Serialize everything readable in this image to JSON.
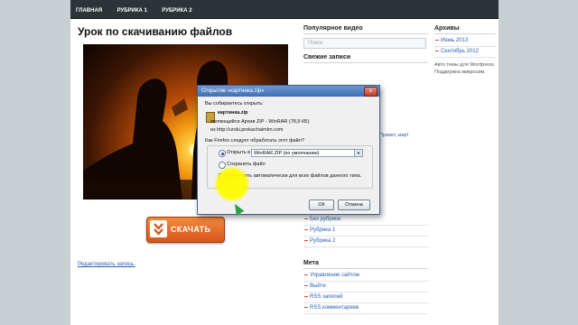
{
  "nav": [
    "Главная",
    "Рубрика 1",
    "Рубрика 2"
  ],
  "post": {
    "title": "Урок по скачиванию файлов",
    "download_label": "СКАЧАТЬ",
    "edit_link": "Редактировать запись."
  },
  "sidebar": {
    "popular_heading": "Популярное видео",
    "search_placeholder": "Поиск",
    "recent_heading": "Свежие записи",
    "categories": [
      "Без рубрики",
      "Рубрика 1",
      "Рубрика 2"
    ],
    "meta_heading": "Мета",
    "meta_links": [
      "Управление сайтом",
      "Выйти",
      "RSS записей",
      "RSS комментариев"
    ],
    "comment_snippet": "Привет, мир!"
  },
  "archives": {
    "heading": "Архивы",
    "items": [
      "Июнь 2013",
      "Сентябрь 2012"
    ],
    "note1": "Авто темы для Wordpress.",
    "note2": "Поддержка микросим."
  },
  "dialog": {
    "title": "Открытие «картинка.zip»",
    "intro": "Вы собираетесь открыть:",
    "filename": "картинка.zip",
    "type_line": "являющийся  Архив ZIP - WinRAR (78,9 КБ)",
    "from_line": "из  http://uroki.prokachaimlm.com",
    "question": "Как Firefox следует обработать этот файл?",
    "open_with_label": "Открыть в",
    "open_with_value": "WinRAR.ZIP (по умолчанию)",
    "save_label": "Сохранить файл",
    "auto_label": "Выполнять автоматически для всех файлов данного типа.",
    "ok_label": "ОК",
    "cancel_label": "Отмена",
    "close_glyph": "x"
  }
}
